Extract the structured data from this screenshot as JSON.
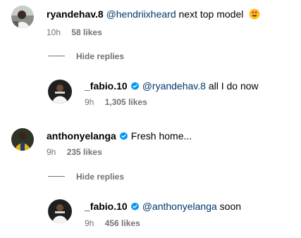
{
  "comments": [
    {
      "username": "ryandehav.8",
      "mention": "@hendriixheard",
      "text": "next top model",
      "emoji": "heart-eyes-emoji",
      "time": "10h",
      "likes": "58 likes",
      "verified": false,
      "replies_toggle": "Hide replies",
      "reply": {
        "username": "_fabio.10",
        "verified": true,
        "mention": "@ryandehav.8",
        "text": "all I do now",
        "time": "9h",
        "likes": "1,305 likes"
      }
    },
    {
      "username": "anthonyelanga",
      "verified": true,
      "text": "Fresh home...",
      "time": "9h",
      "likes": "235 likes",
      "replies_toggle": "Hide replies",
      "reply": {
        "username": "_fabio.10",
        "verified": true,
        "mention": "@anthonyelanga",
        "text": "soon",
        "time": "9h",
        "likes": "456 likes"
      }
    }
  ],
  "colors": {
    "verified_badge": "#0095f6",
    "mention": "#00376b",
    "meta_gray": "#737373",
    "emoji_face": "#fcc21b",
    "emoji_heart": "#e0245e"
  }
}
